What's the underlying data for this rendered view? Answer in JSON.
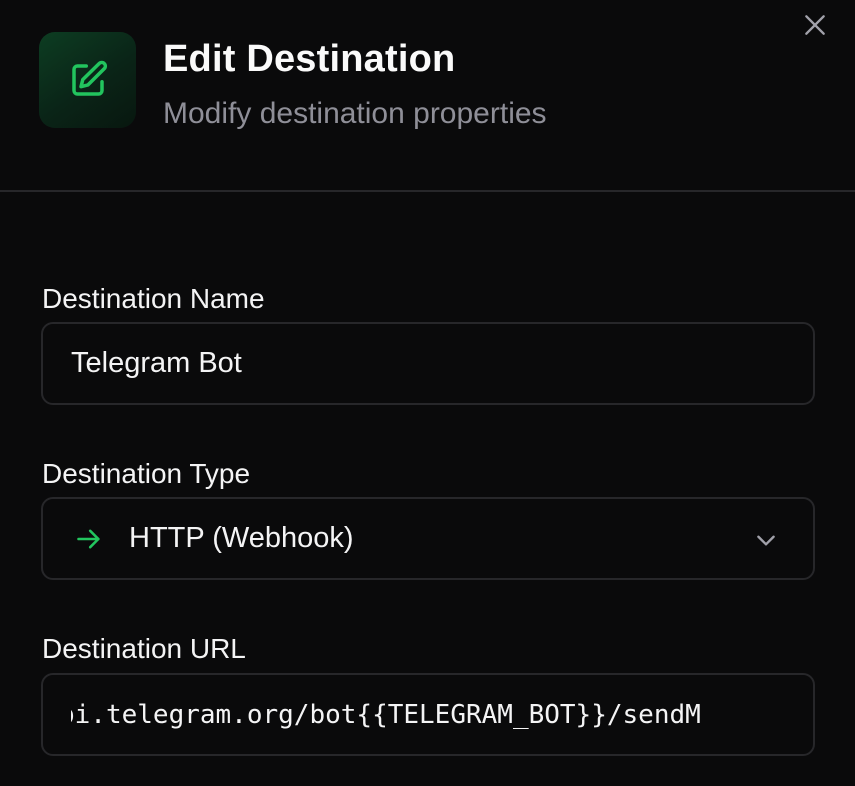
{
  "dialog": {
    "title": "Edit Destination",
    "subtitle": "Modify destination properties",
    "accent_color": "#22c55e"
  },
  "icons": {
    "header": "edit-icon",
    "close": "close-icon",
    "type_arrow": "arrow-right-icon",
    "dropdown": "chevron-down-icon"
  },
  "form": {
    "name": {
      "label": "Destination Name",
      "value": "Telegram Bot"
    },
    "type": {
      "label": "Destination Type",
      "selected": "HTTP (Webhook)"
    },
    "url": {
      "label": "Destination URL",
      "value": "pi.telegram.org/bot{{TELEGRAM_BOT}}/sendM"
    }
  }
}
